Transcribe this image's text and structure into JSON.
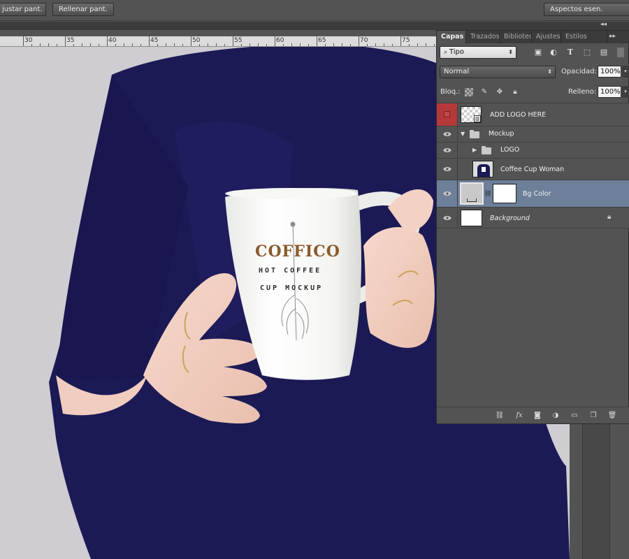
{
  "options_bar": {
    "fit_screen_label": "justar pant.",
    "fill_screen_label": "Rellenar pant.",
    "workspace_label": "Aspectos esen."
  },
  "ruler": {
    "numbers": [
      "30",
      "35",
      "40",
      "45",
      "50",
      "55",
      "60",
      "65",
      "70",
      "75"
    ]
  },
  "mug": {
    "brand": "COFFICO",
    "line1": "HOT COFFEE",
    "line2": "CUP MOCKUP"
  },
  "layers_panel": {
    "tabs": [
      "Capas",
      "Trazados",
      "Bibliotecas",
      "Ajustes",
      "Estilos"
    ],
    "filter": {
      "label": "Tipo"
    },
    "blend_mode": "Normal",
    "opacity_label": "Opacidad:",
    "opacity_value": "100%",
    "lock_label": "Bloq.:",
    "fill_label": "Relleno:",
    "fill_value": "100%",
    "layers": [
      {
        "name": "ADD LOGO HERE",
        "visible": false,
        "type": "smart-object"
      },
      {
        "name": "Mockup",
        "visible": true,
        "type": "group",
        "expanded": true
      },
      {
        "name": "LOGO",
        "visible": true,
        "type": "group",
        "expanded": false
      },
      {
        "name": "Coffee Cup Woman",
        "visible": true,
        "type": "image"
      },
      {
        "name": "Bg Color",
        "visible": true,
        "type": "fill-with-mask",
        "selected": true
      },
      {
        "name": "Background",
        "visible": true,
        "type": "background",
        "locked": true
      }
    ]
  },
  "colors": {
    "ui_gray": "#535353",
    "selection": "#6d7f99",
    "sweater": "#1c1a55",
    "canvas_bg": "#cfcdd2",
    "brand": "#8a5a2b",
    "hidden_layer_red": "#b5393a"
  }
}
